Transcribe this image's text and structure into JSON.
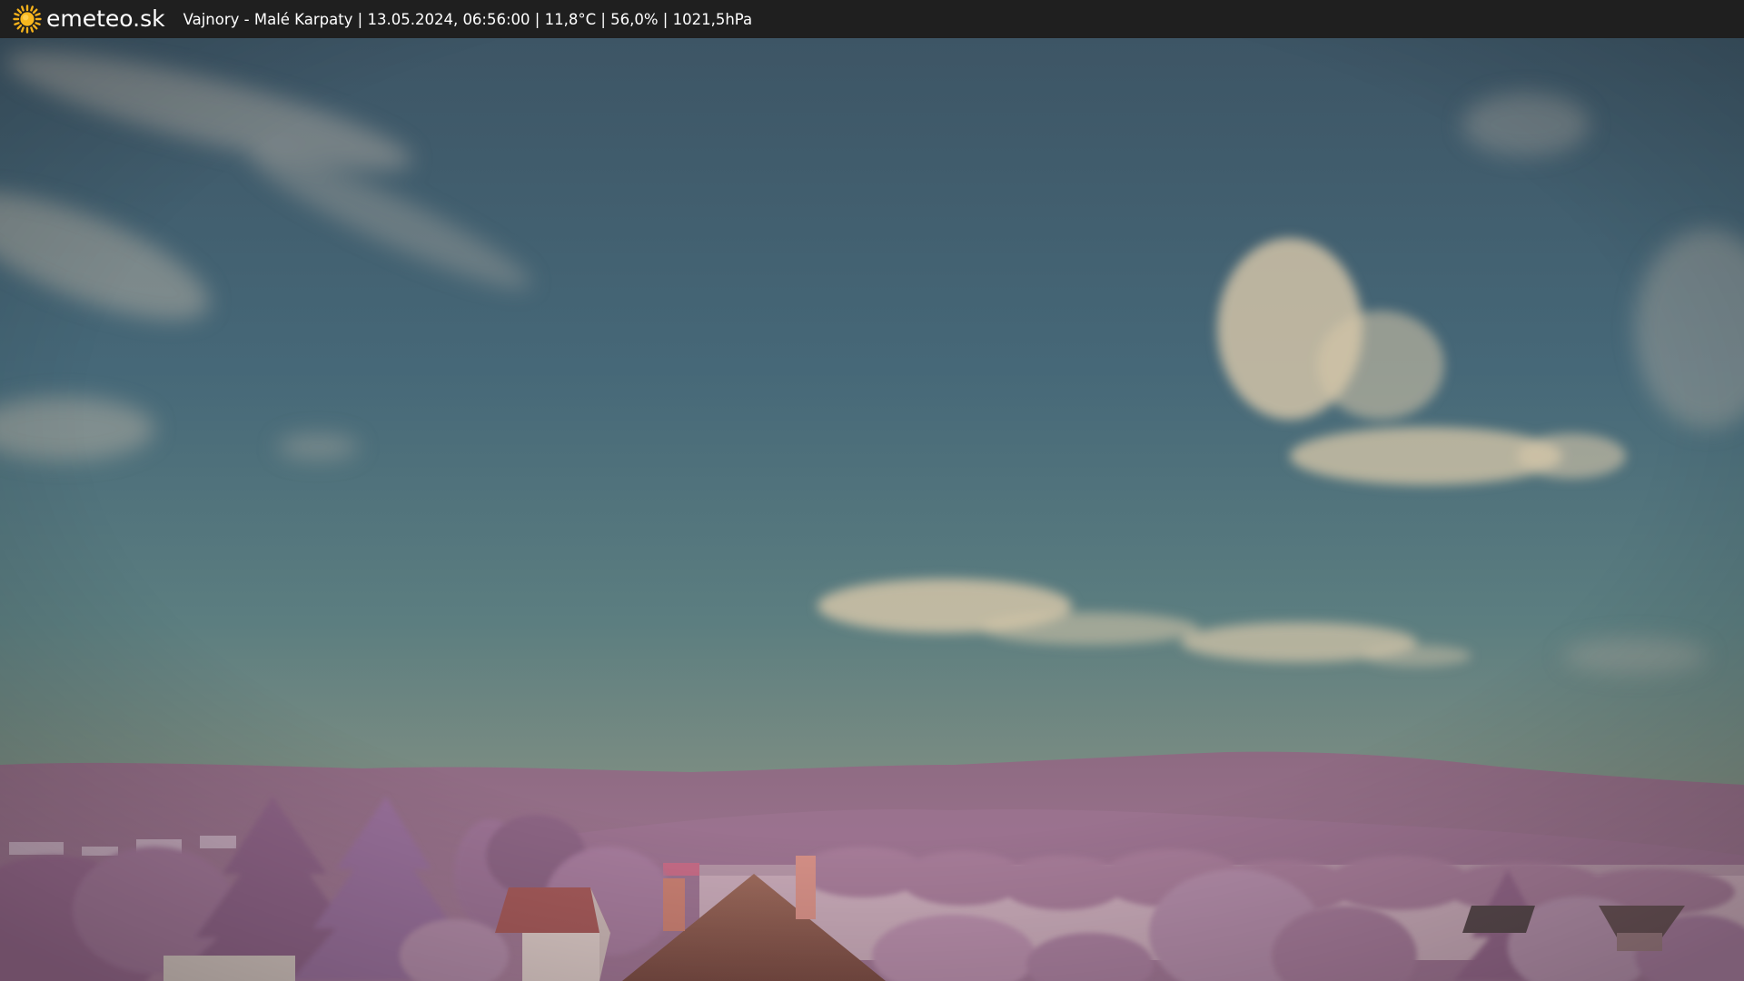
{
  "header": {
    "brand": "emeteo.sk",
    "caption": "Vajnory - Malé Karpaty | 13.05.2024, 06:56:00 | 11,8°C | 56,0% | 1021,5hPa",
    "logo_icon": "sun-icon"
  },
  "colors": {
    "bar_background": "#1f1f1f",
    "sun": "#f5b21b",
    "sky_top": "#3f5866",
    "sky_horizon": "#8e8e80",
    "hills": "#9a6f8c",
    "foliage": "#b98aa6"
  }
}
